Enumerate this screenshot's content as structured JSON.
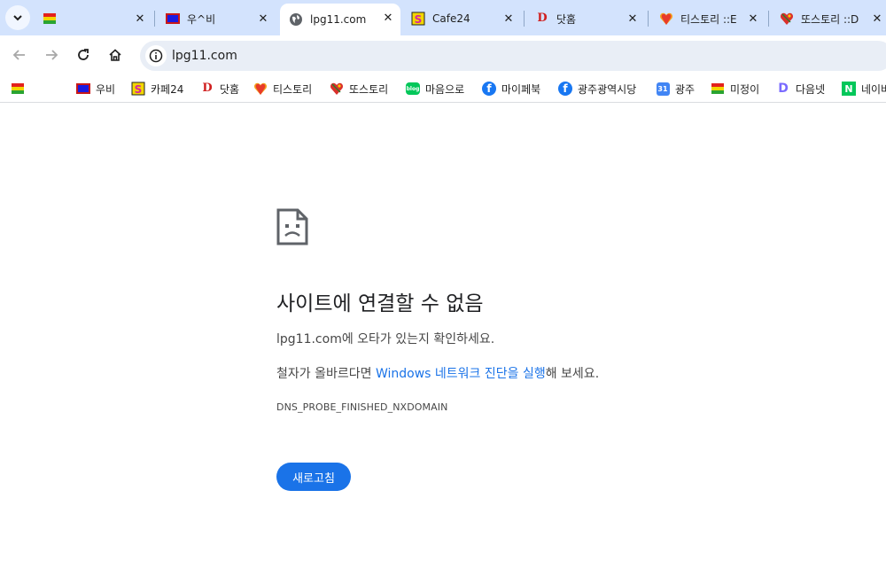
{
  "tabs": [
    {
      "label": "",
      "icon": "rainbow-stripes-icon"
    },
    {
      "label": "우^비",
      "icon": "blue-box-icon"
    },
    {
      "label": "lpg11.com",
      "icon": "globe-icon",
      "active": true
    },
    {
      "label": "Cafe24",
      "icon": "cafe24-icon"
    },
    {
      "label": "닷홈",
      "icon": "d-letter-icon"
    },
    {
      "label": "티스토리 ::E",
      "icon": "heart-icon"
    },
    {
      "label": "또스토리 ::D",
      "icon": "heart-pin-icon"
    }
  ],
  "toolbar": {
    "url": "lpg11.com"
  },
  "bookmarks": [
    {
      "label": "",
      "icon": "rainbow-stripes-icon"
    },
    {
      "label": "우비",
      "icon": "blue-box-icon"
    },
    {
      "label": "카페24",
      "icon": "cafe24-icon"
    },
    {
      "label": "닷홈",
      "icon": "d-letter-icon"
    },
    {
      "label": "티스토리",
      "icon": "heart-icon"
    },
    {
      "label": "또스토리",
      "icon": "heart-pin-icon"
    },
    {
      "label": "마음으로",
      "icon": "blog-icon"
    },
    {
      "label": "마이페북",
      "icon": "facebook-icon"
    },
    {
      "label": "광주광역시당",
      "icon": "facebook-icon"
    },
    {
      "label": "광주",
      "icon": "calendar-icon"
    },
    {
      "label": "미정이",
      "icon": "rainbow-stripes-icon"
    },
    {
      "label": "다음넷",
      "icon": "daum-icon"
    },
    {
      "label": "네이버",
      "icon": "naver-icon"
    }
  ],
  "error": {
    "title": "사이트에 연결할 수 없음",
    "line1": "lpg11.com에 오타가 있는지 확인하세요.",
    "line2_prefix": "철자가 올바르다면 ",
    "line2_link": "Windows 네트워크 진단을 실행",
    "line2_suffix": "해 보세요.",
    "code": "DNS_PROBE_FINISHED_NXDOMAIN",
    "reload_label": "새로고침"
  },
  "colors": {
    "tabstrip": "#d3e3fd",
    "link": "#1a73e8",
    "button": "#1a73e8"
  },
  "misc": {
    "calendar_day": "31",
    "blog_text": "blog",
    "facebook_letter": "f",
    "naver_letter": "N",
    "daum_letter": "D",
    "dothome_letter": "D"
  }
}
